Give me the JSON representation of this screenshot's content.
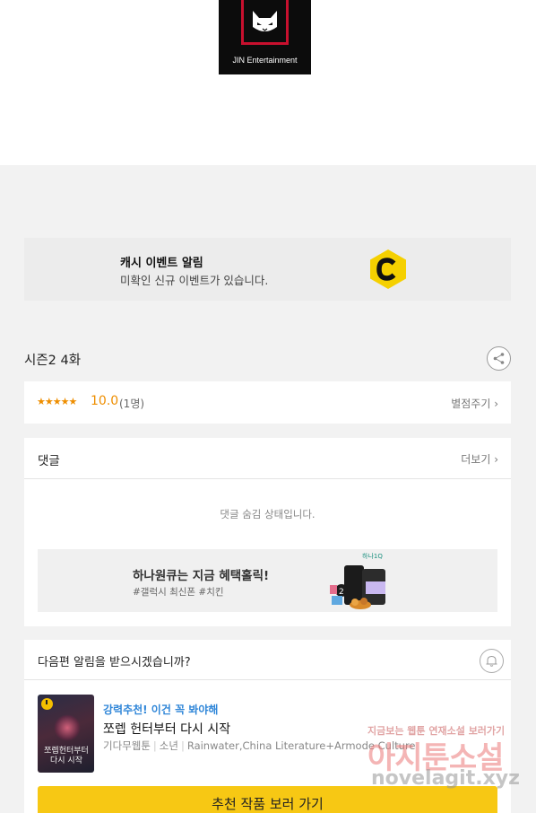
{
  "publisher": {
    "brand": "JIN Entertainment"
  },
  "event_banner": {
    "title": "캐시 이벤트 알림",
    "description": "미확인 신규 이벤트가 있습니다.",
    "icon": "cash-c-icon",
    "accent_color": "#f5d000"
  },
  "episode": {
    "title": "시즌2 4화"
  },
  "rating": {
    "stars": "★★★★★",
    "score": "10.0",
    "count": "(1명)",
    "rate_link": "별점주기 ›"
  },
  "comments": {
    "label": "댓글",
    "more_link": "더보기 ›",
    "hidden_message": "댓글 숨김 상태입니다.",
    "ad": {
      "title": "하나원큐는 지금 혜택홀릭!",
      "tags": "#갤럭시 최신폰 #치킨",
      "brand_mark": "하나1Q"
    }
  },
  "next_notify": {
    "question": "다음편 알림을 받으시겠습니까?",
    "recommend_label": "강력추천! 이건 꼭 봐야해",
    "work_title": "쪼렙 헌터부터 다시 시작",
    "meta": [
      "기다무웹툰",
      "소년",
      "Rainwater,China Literature+Armode Culture"
    ],
    "thumb_title": "쪼렙헌터부터 다시 시작",
    "cta_label": "추천 작품 보러 가기",
    "cta_color": "#f7c814"
  },
  "watermark": {
    "line1": "지금보는 웹툰 연재소설 보러가기",
    "line2": "아지툰소설",
    "line3": "novelagit.xyz"
  }
}
